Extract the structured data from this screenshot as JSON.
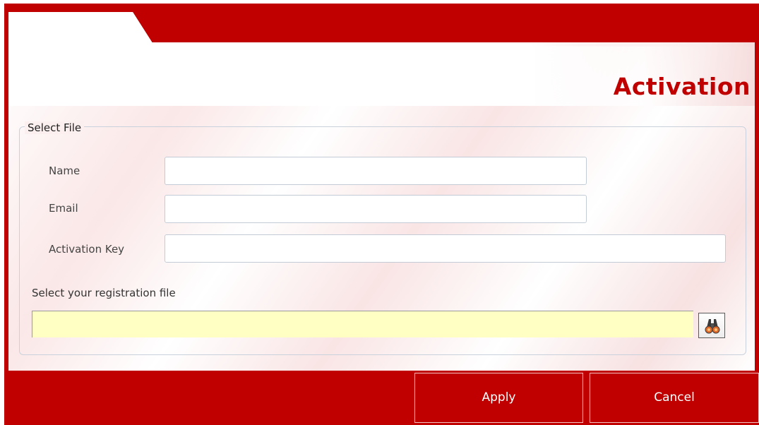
{
  "dialog": {
    "title": "Activation",
    "accent_color": "#c00000"
  },
  "select_file_group": {
    "legend": "Select File",
    "fields": [
      {
        "label": "Name",
        "value": "",
        "placeholder": ""
      },
      {
        "label": "Email",
        "value": "",
        "placeholder": ""
      },
      {
        "label": "Activation Key",
        "value": "",
        "placeholder": ""
      }
    ],
    "file_prompt": "Select your registration file",
    "file_path_value": "",
    "file_input_color": "#ffffc4",
    "browse_icon": "binoculars-icon"
  },
  "buttons": {
    "apply_label": "Apply",
    "cancel_label": "Cancel"
  }
}
